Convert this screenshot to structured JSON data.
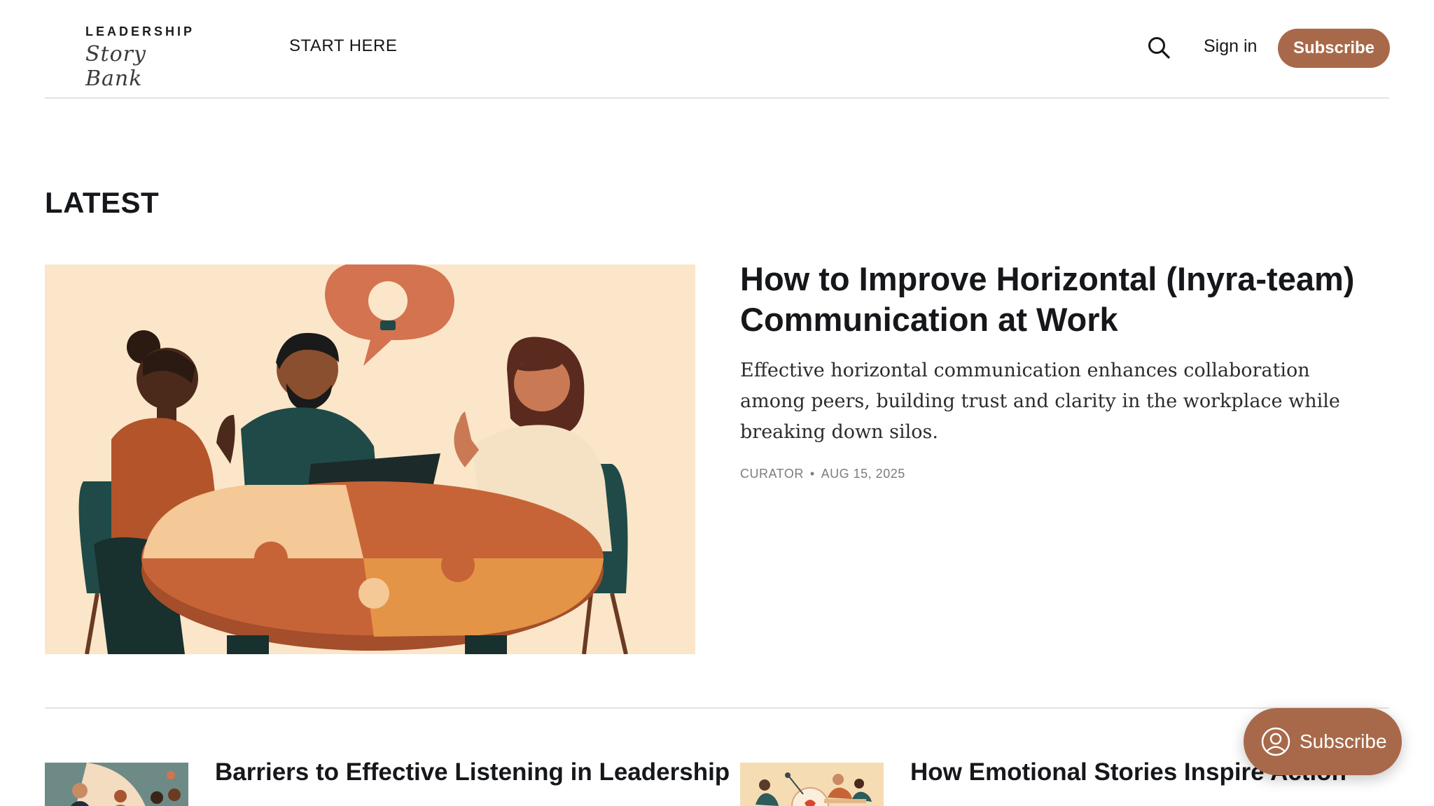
{
  "header": {
    "logo_top": "LEADERSHIP",
    "logo_script": "Story Bank",
    "nav_start": "START HERE",
    "signin": "Sign in",
    "subscribe": "Subscribe"
  },
  "section": {
    "title": "LATEST"
  },
  "featured": {
    "title": "How to Improve Horizontal (Inyra-team) Communication at Work",
    "excerpt": "Effective horizontal communication enhances collaboration among peers, building trust and clarity in the workplace while breaking down silos.",
    "author": "CURATOR",
    "separator": "•",
    "date": "AUG 15, 2025"
  },
  "posts": [
    {
      "title": "Barriers to Effective Listening in Leadership"
    },
    {
      "title": "How Emotional Stories Inspire Action"
    }
  ],
  "floating": {
    "label": "Subscribe"
  },
  "colors": {
    "accent": "#a8694a",
    "divider": "#e4e4e4",
    "illustration_bg": "#fbe6c9"
  }
}
